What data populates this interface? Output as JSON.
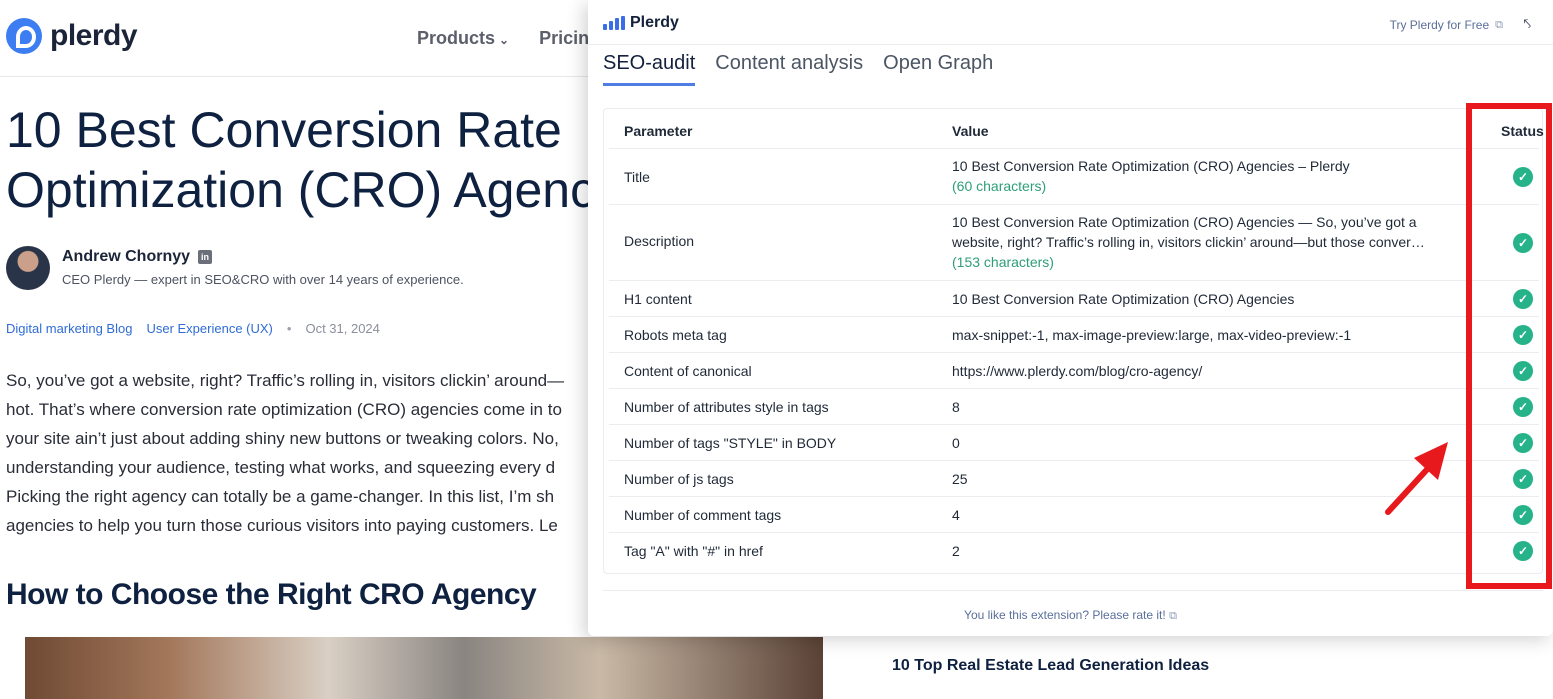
{
  "site": {
    "logo_text": "plerdy",
    "nav": [
      {
        "label": "Products",
        "chevron": "⌄"
      },
      {
        "label": "Pricin"
      }
    ]
  },
  "article": {
    "title_lines": [
      "10 Best Conversion Rate",
      "Optimization (CRO) Agenc"
    ],
    "author_name": "Andrew Chornyy",
    "author_bio": "CEO Plerdy — expert in SEO&CRO with over 14 years of experience.",
    "categories": [
      "Digital marketing Blog",
      "User Experience (UX)"
    ],
    "date": "Oct 31, 2024",
    "body_lines": [
      "So, you’ve got a website, right? Traffic’s rolling in, visitors clickin’ around—",
      "hot. That’s where conversion rate optimization (CRO) agencies come in to",
      "your site ain’t just about adding shiny new buttons or tweaking colors. No,",
      "understanding your audience, testing what works, and squeezing every d",
      "Picking the right agency can totally be a game-changer. In this list, I’m sh",
      "agencies to help you turn those curious visitors into paying customers. Le"
    ],
    "section_heading": "How to Choose the Right CRO Agency",
    "related_link": "10 Top Real Estate Lead Generation Ideas"
  },
  "extension": {
    "logo_text": "Plerdy",
    "try_free": "Try Plerdy for Free",
    "tabs": [
      "SEO-audit",
      "Content analysis",
      "Open Graph"
    ],
    "active_tab": "SEO-audit",
    "table": {
      "headers": [
        "Parameter",
        "Value",
        "Status"
      ],
      "rows": [
        {
          "param": "Title",
          "value": "10 Best Conversion Rate Optimization (CRO) Agencies – Plerdy",
          "extra": "(60 characters)",
          "status": "ok"
        },
        {
          "param": "Description",
          "value": "10 Best Conversion Rate Optimization (CRO) Agencies — So, you’ve got a website, right? Traffic’s rolling in, visitors clickin’ around—but those conver…",
          "extra": "(153 characters)",
          "status": "ok"
        },
        {
          "param": "H1 content",
          "value": "10 Best Conversion Rate Optimization (CRO) Agencies",
          "status": "ok"
        },
        {
          "param": "Robots meta tag",
          "value": "max-snippet:-1, max-image-preview:large, max-video-preview:-1",
          "status": "ok"
        },
        {
          "param": "Content of canonical",
          "value": "https://www.plerdy.com/blog/cro-agency/",
          "status": "ok"
        },
        {
          "param": "Number of attributes style in tags",
          "value": "8",
          "status": "ok"
        },
        {
          "param": "Number of tags \"STYLE\" in BODY",
          "value": "0",
          "status": "ok"
        },
        {
          "param": "Number of js tags",
          "value": "25",
          "status": "ok"
        },
        {
          "param": "Number of comment tags",
          "value": "4",
          "status": "ok"
        },
        {
          "param": "Tag \"A\" with \"#\" in href",
          "value": "2",
          "status": "ok"
        }
      ]
    },
    "rate_text": "You like this extension? Please rate it!"
  },
  "colors": {
    "accent": "#4f7de3",
    "status_ok": "#26b38a",
    "annotation_red": "#e8191c"
  },
  "icons": {
    "status_ok": "check-circle-icon",
    "external": "external-link-icon",
    "pin": "pin-icon"
  }
}
